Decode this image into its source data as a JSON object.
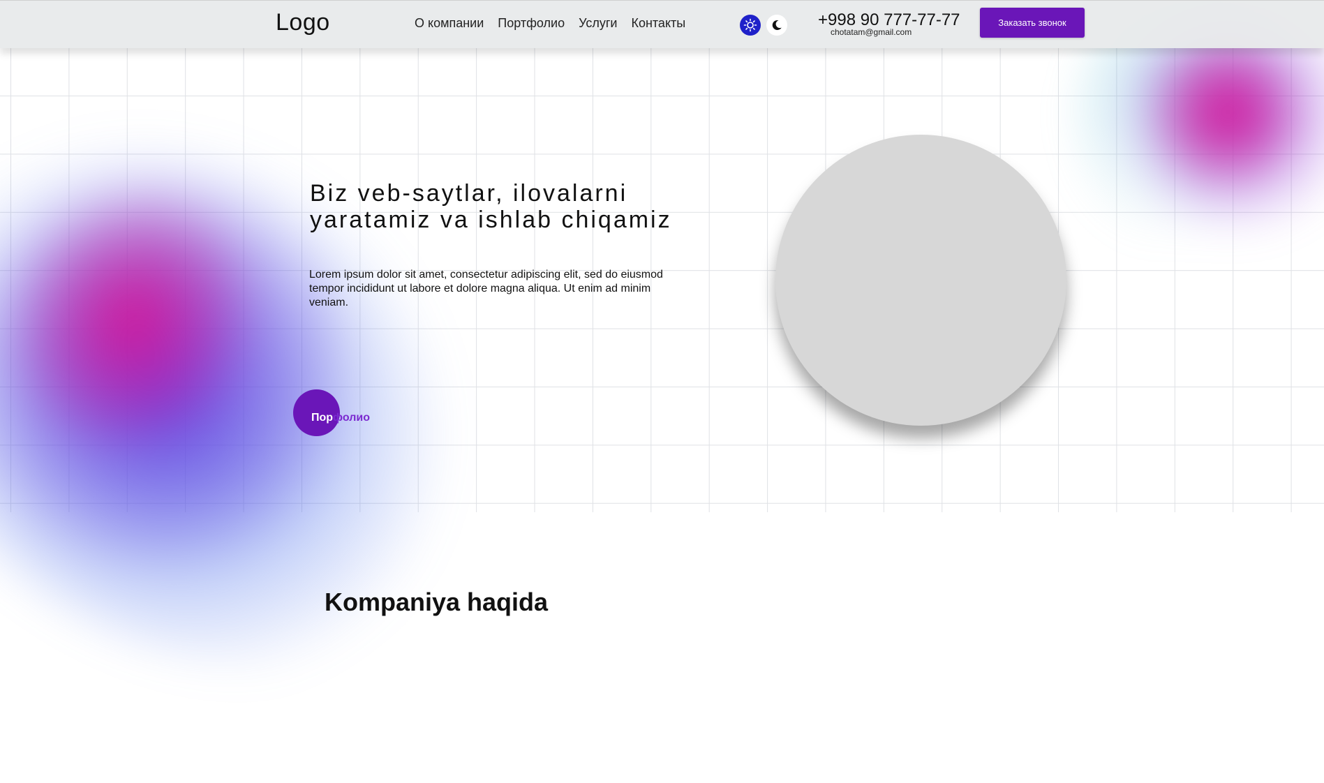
{
  "header": {
    "logo": "Logo",
    "nav": [
      "О компании",
      "Портфолио",
      "Услуги",
      "Контакты"
    ],
    "phone": "+998 90 777-77-77",
    "email": "chotatam@gmail.com",
    "call_button": "Заказать звонок"
  },
  "hero": {
    "title": "Biz veb-saytlar, ilovalarni yaratamiz va ishlab chiqamiz",
    "text": "Lorem ipsum dolor sit amet, consectetur adipiscing elit, sed do eiusmod tempor incididunt ut labore et dolore magna aliqua. Ut enim ad minim veniam.",
    "button_part1": "Пор",
    "button_part2": "фолио"
  },
  "about": {
    "title": "Kompaniya haqida"
  },
  "icons": {
    "theme_light": "sun-icon",
    "theme_dark": "moon-icon"
  },
  "colors": {
    "accent": "#6a16b8",
    "theme_active": "#1f21c9",
    "image_placeholder": "#d7d7d7"
  }
}
